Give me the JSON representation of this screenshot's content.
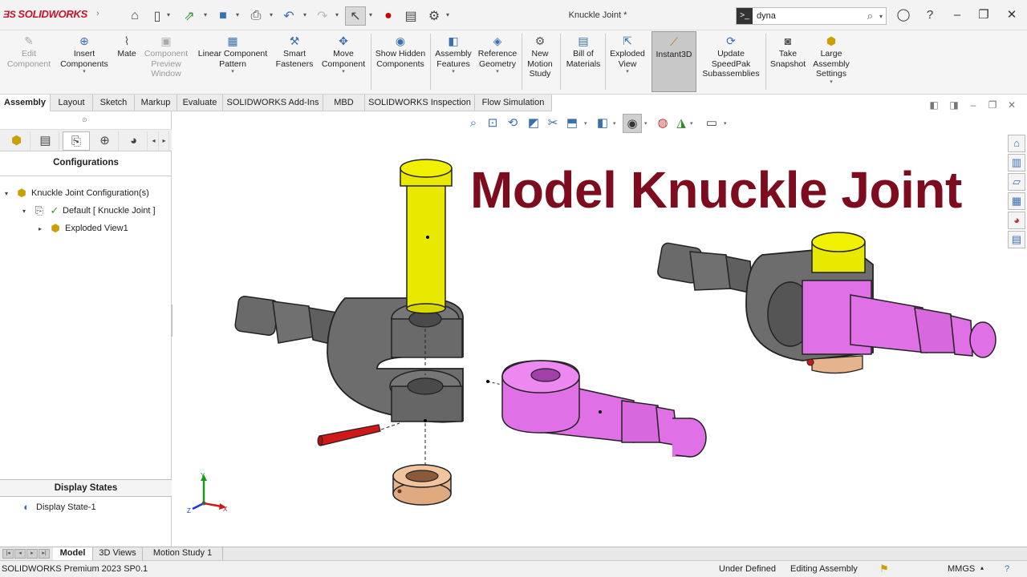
{
  "app": {
    "brand": "SOLIDWORKS",
    "document_title": "Knuckle Joint *"
  },
  "search": {
    "value": "dyna"
  },
  "commands": [
    {
      "label": "Edit Component",
      "disabled": true
    },
    {
      "label": "Insert Components"
    },
    {
      "label": "Mate"
    },
    {
      "label": "Component Preview Window",
      "disabled": true
    },
    {
      "label": "Linear Component Pattern"
    },
    {
      "label": "Smart Fasteners"
    },
    {
      "label": "Move Component"
    },
    {
      "label": "Show Hidden Components"
    },
    {
      "label": "Assembly Features"
    },
    {
      "label": "Reference Geometry"
    },
    {
      "label": "New Motion Study"
    },
    {
      "label": "Bill of Materials"
    },
    {
      "label": "Exploded View"
    },
    {
      "label": "Instant3D",
      "active": true
    },
    {
      "label": "Update SpeedPak Subassemblies"
    },
    {
      "label": "Take Snapshot"
    },
    {
      "label": "Large Assembly Settings"
    }
  ],
  "tabs": [
    "Assembly",
    "Layout",
    "Sketch",
    "Markup",
    "Evaluate",
    "SOLIDWORKS Add-Ins",
    "MBD",
    "SOLIDWORKS Inspection",
    "Flow Simulation"
  ],
  "config_panel": {
    "title": "Configurations",
    "root": "Knuckle Joint Configuration(s)",
    "default_config": "Default [ Knuckle Joint ]",
    "exploded": "Exploded View1",
    "display_states_title": "Display States",
    "display_state": "Display State-1"
  },
  "overlay_title": "Model Knuckle Joint",
  "axes": {
    "x": "X",
    "y": "Y",
    "z": "Z"
  },
  "bottom_tabs": [
    "Model",
    "3D Views",
    "Motion Study 1"
  ],
  "status": {
    "product": "SOLIDWORKS Premium 2023 SP0.1",
    "state": "Under Defined",
    "mode": "Editing Assembly",
    "units": "MMGS"
  },
  "colors": {
    "title": "#7d0d1e",
    "brand": "#c8102e",
    "pin": "#e8e800",
    "eye": "#e070e6",
    "fork": "#6a6a6a",
    "collar": "#e6b48c",
    "taper_pin": "#d01818"
  }
}
